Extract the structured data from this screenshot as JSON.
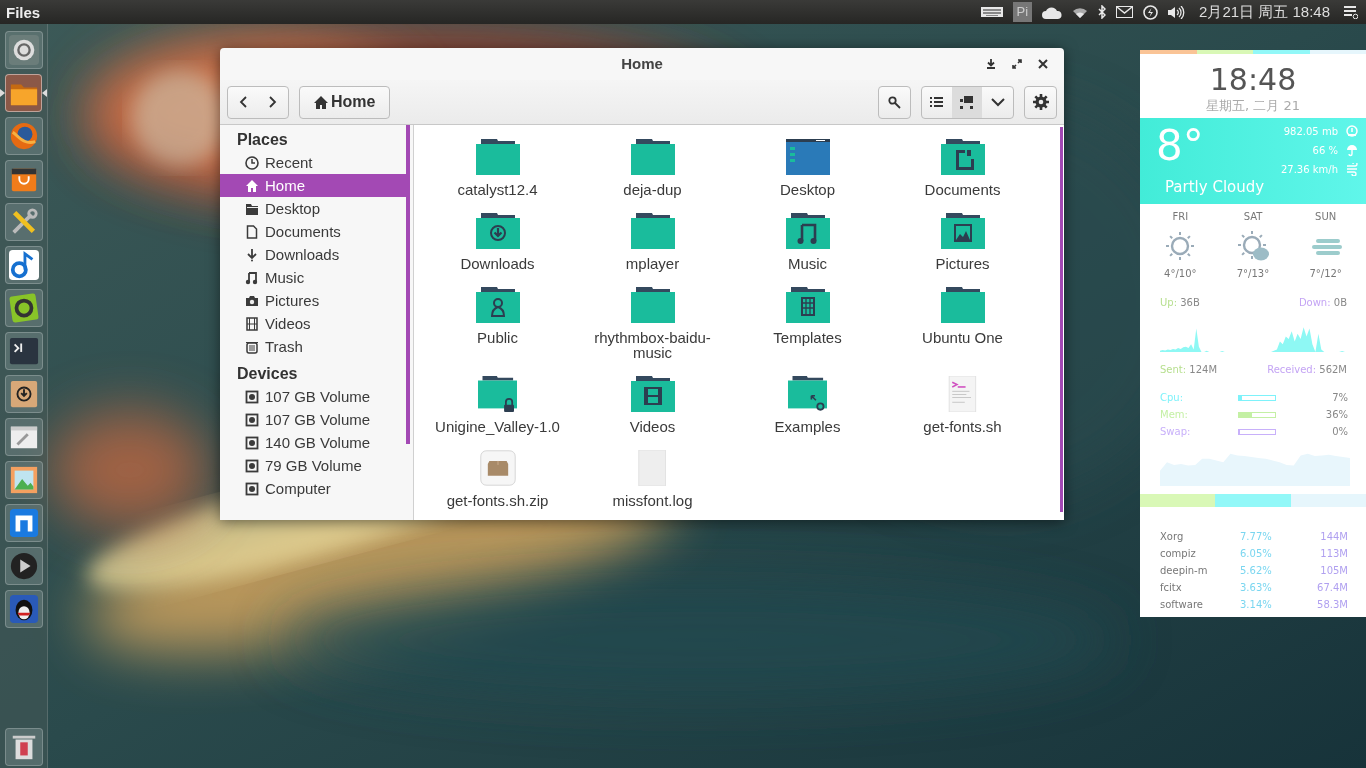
{
  "top_panel": {
    "app_title": "Files",
    "pi_badge": "Pi",
    "clock": "2月21日 周五 18:48"
  },
  "launcher": {
    "items": [
      {
        "kind": "circle-logo",
        "selected": false
      },
      {
        "kind": "folder",
        "selected": true
      },
      {
        "kind": "globe",
        "selected": false
      },
      {
        "kind": "bag",
        "selected": false
      },
      {
        "kind": "tools",
        "selected": false
      },
      {
        "kind": "note",
        "selected": false
      },
      {
        "kind": "green-gear",
        "selected": false
      },
      {
        "kind": "terminal",
        "selected": false
      },
      {
        "kind": "download-box",
        "selected": false
      },
      {
        "kind": "wrench-window",
        "selected": false
      },
      {
        "kind": "image-frame",
        "selected": false
      },
      {
        "kind": "arch",
        "selected": false
      },
      {
        "kind": "play",
        "selected": false
      },
      {
        "kind": "penguin",
        "selected": false
      }
    ],
    "trash": {
      "kind": "trash"
    }
  },
  "files_window": {
    "title": "Home",
    "path_button": "Home",
    "view_buttons": [
      {
        "kind": "list",
        "selected": false
      },
      {
        "kind": "grid",
        "selected": true
      },
      {
        "kind": "menu",
        "selected": false
      }
    ],
    "sidebar": [
      {
        "heading": "Places",
        "items": [
          {
            "label": "Recent",
            "kind": "recent",
            "selected": false
          },
          {
            "label": "Home",
            "kind": "home",
            "selected": true
          },
          {
            "label": "Desktop",
            "kind": "desktop",
            "selected": false
          },
          {
            "label": "Documents",
            "kind": "documents",
            "selected": false
          },
          {
            "label": "Downloads",
            "kind": "downloads",
            "selected": false
          },
          {
            "label": "Music",
            "kind": "music",
            "selected": false
          },
          {
            "label": "Pictures",
            "kind": "pictures",
            "selected": false
          },
          {
            "label": "Videos",
            "kind": "videos",
            "selected": false
          },
          {
            "label": "Trash",
            "kind": "trash",
            "selected": false
          }
        ]
      },
      {
        "heading": "Devices",
        "items": [
          {
            "label": "107 GB Volume",
            "kind": "drive",
            "selected": false
          },
          {
            "label": "107 GB Volume",
            "kind": "drive",
            "selected": false
          },
          {
            "label": "140 GB Volume",
            "kind": "drive",
            "selected": false
          },
          {
            "label": "79 GB Volume",
            "kind": "drive",
            "selected": false
          },
          {
            "label": "Computer",
            "kind": "drive",
            "selected": false
          }
        ]
      }
    ],
    "files": [
      {
        "name": "catalyst12.4",
        "kind": "folder"
      },
      {
        "name": "deja-dup",
        "kind": "folder"
      },
      {
        "name": "Desktop",
        "kind": "desktop"
      },
      {
        "name": "Documents",
        "kind": "documents"
      },
      {
        "name": "Downloads",
        "kind": "download"
      },
      {
        "name": "mplayer",
        "kind": "folder"
      },
      {
        "name": "Music",
        "kind": "music"
      },
      {
        "name": "Pictures",
        "kind": "pictures"
      },
      {
        "name": "Public",
        "kind": "public"
      },
      {
        "name": "rhythmbox-baidu-music",
        "kind": "folder"
      },
      {
        "name": "Templates",
        "kind": "templates"
      },
      {
        "name": "Ubuntu One",
        "kind": "folder"
      },
      {
        "name": "Unigine_Valley-1.0",
        "kind": "locked"
      },
      {
        "name": "Videos",
        "kind": "videos"
      },
      {
        "name": "Examples",
        "kind": "examples"
      },
      {
        "name": "get-fonts.sh",
        "kind": "script"
      },
      {
        "name": "get-fonts.sh.zip",
        "kind": "archive"
      },
      {
        "name": "missfont.log",
        "kind": "text"
      }
    ]
  },
  "conky": {
    "time": "18:48",
    "date": "星期五, 二月 21",
    "weather": {
      "temperature": "8°",
      "condition": "Partly Cloudy",
      "details": [
        {
          "value": "982.05 mb",
          "kind": "gauge"
        },
        {
          "value": "66 %",
          "kind": "umbrella"
        },
        {
          "value": "27.36 km/h",
          "kind": "wind"
        }
      ]
    },
    "forecast": [
      {
        "day": "FRI",
        "kind": "sun",
        "temps": "4°/10°"
      },
      {
        "day": "SAT",
        "kind": "sun-cloud",
        "temps": "7°/13°"
      },
      {
        "day": "SUN",
        "kind": "fog",
        "temps": "7°/12°"
      }
    ],
    "network": {
      "up": {
        "label": "Up:",
        "value": "36B"
      },
      "down": {
        "label": "Down:",
        "value": "0B"
      },
      "sent": {
        "label": "Sent:",
        "value": "124M"
      },
      "received": {
        "label": "Received:",
        "value": "562M"
      }
    },
    "meters": [
      {
        "label": "Cpu:",
        "color": "#7ef2fa",
        "level": 0.07,
        "reading": "7%"
      },
      {
        "label": "Mem:",
        "color": "#c4f0a4",
        "level": 0.36,
        "reading": "36%"
      },
      {
        "label": "Swap:",
        "color": "#c8b0fa",
        "level": 0,
        "reading": "0%"
      }
    ],
    "processes": [
      {
        "name": "Xorg",
        "percent": "7.77%",
        "memory": "144M"
      },
      {
        "name": "compiz",
        "percent": "6.05%",
        "memory": "113M"
      },
      {
        "name": "deepin-m",
        "percent": "5.62%",
        "memory": "105M"
      },
      {
        "name": "fcitx",
        "percent": "3.63%",
        "memory": "67.4M"
      },
      {
        "name": "software",
        "percent": "3.14%",
        "memory": "58.3M"
      }
    ]
  }
}
